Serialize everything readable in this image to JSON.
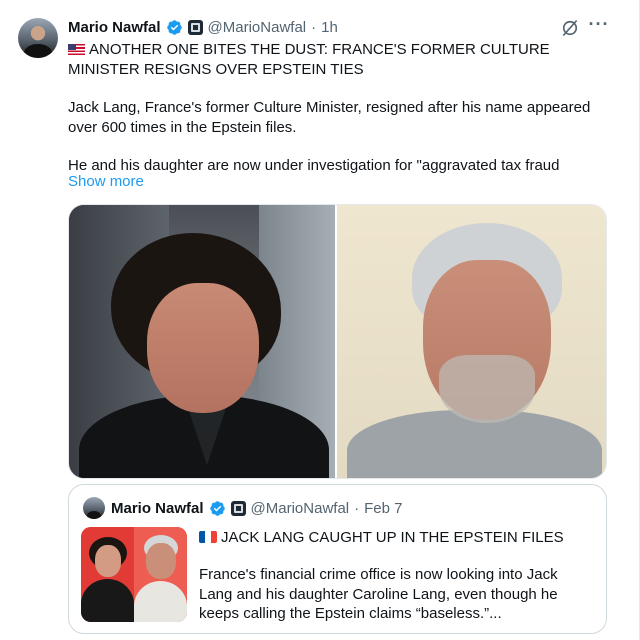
{
  "tweet": {
    "author_name": "Mario Nawfal",
    "handle": "@MarioNawfal",
    "separator": "·",
    "time": "1h",
    "headline": "ANOTHER ONE BITES THE DUST: FRANCE'S FORMER CULTURE MINISTER RESIGNS OVER EPSTEIN TIES",
    "paragraph_1": "Jack Lang, France's former Culture Minister, resigned after his name appeared over 600 times in the Epstein files.",
    "paragraph_2": "He and his daughter are now under investigation for \"aggravated tax fraud",
    "show_more": "Show more",
    "icons": {
      "verified": "verified-badge-icon",
      "affiliate": "affiliate-badge-icon",
      "grok": "grok-icon",
      "more": "more-options-icon",
      "flag": "us-flag-icon"
    },
    "more_glyph": "···"
  },
  "quote": {
    "author_name": "Mario Nawfal",
    "handle": "@MarioNawfal",
    "separator": "·",
    "time": "Feb 7",
    "title": "JACK LANG CAUGHT UP IN THE EPSTEIN FILES",
    "text": "France's financial crime office is now looking into Jack Lang and his daughter Caroline Lang, even though he keeps calling the Epstein claims “baseless.”...",
    "icons": {
      "flag": "fr-flag-icon"
    }
  },
  "colors": {
    "text": "#0f1419",
    "secondary": "#536471",
    "link": "#1d9bf0",
    "verified": "#1d9bf0",
    "border": "#cfd9de"
  }
}
